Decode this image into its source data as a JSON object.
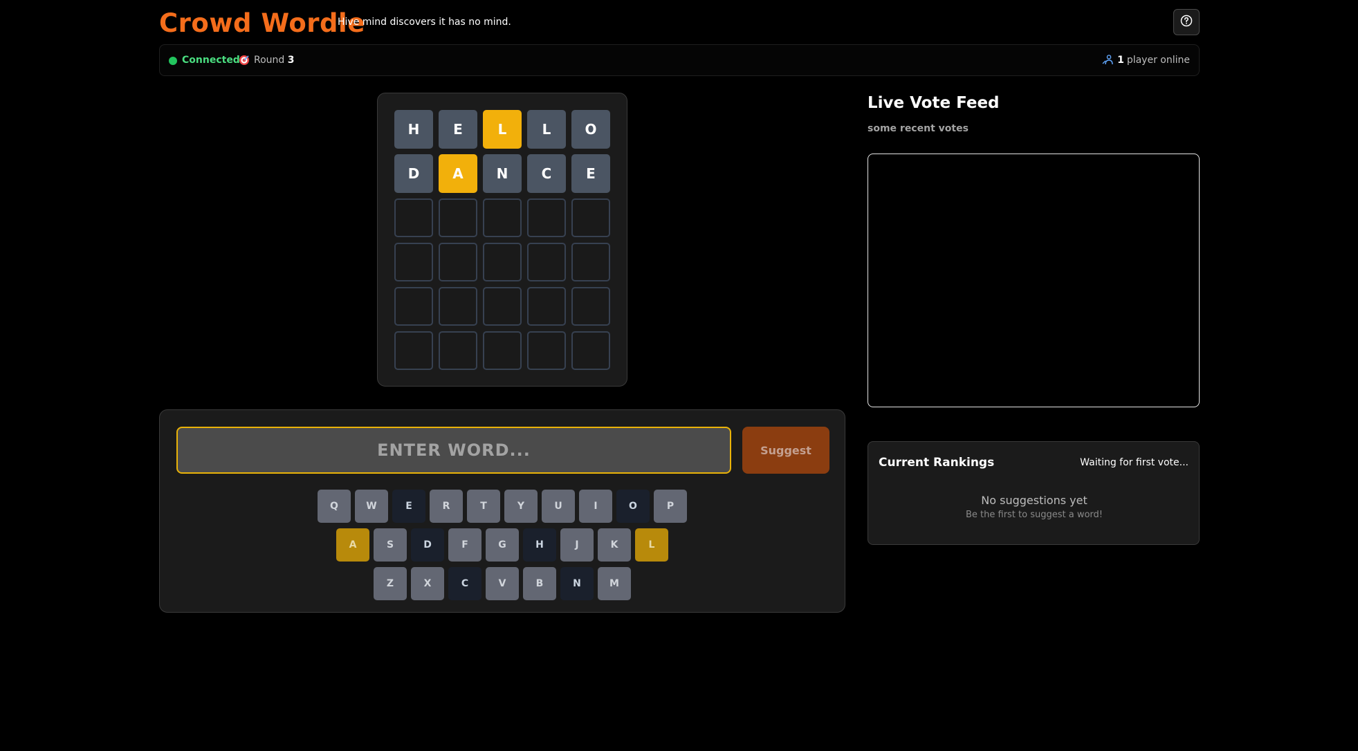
{
  "header": {
    "title": "Crowd Wordle",
    "tagline": "Hive mind discovers it has no mind.",
    "help_icon": "question-circle-icon"
  },
  "status": {
    "connection": "Connected",
    "round_label": "Round",
    "round_number": "3",
    "players_count": "1",
    "players_label": "player online",
    "colors": {
      "connected": "#22c55e"
    }
  },
  "board": {
    "rows": [
      [
        {
          "l": "H",
          "s": "absent"
        },
        {
          "l": "E",
          "s": "absent"
        },
        {
          "l": "L",
          "s": "present"
        },
        {
          "l": "L",
          "s": "absent"
        },
        {
          "l": "O",
          "s": "absent"
        }
      ],
      [
        {
          "l": "D",
          "s": "absent"
        },
        {
          "l": "A",
          "s": "present"
        },
        {
          "l": "N",
          "s": "absent"
        },
        {
          "l": "C",
          "s": "absent"
        },
        {
          "l": "E",
          "s": "absent"
        }
      ],
      [
        {
          "l": "",
          "s": "empty"
        },
        {
          "l": "",
          "s": "empty"
        },
        {
          "l": "",
          "s": "empty"
        },
        {
          "l": "",
          "s": "empty"
        },
        {
          "l": "",
          "s": "empty"
        }
      ],
      [
        {
          "l": "",
          "s": "empty"
        },
        {
          "l": "",
          "s": "empty"
        },
        {
          "l": "",
          "s": "empty"
        },
        {
          "l": "",
          "s": "empty"
        },
        {
          "l": "",
          "s": "empty"
        }
      ],
      [
        {
          "l": "",
          "s": "empty"
        },
        {
          "l": "",
          "s": "empty"
        },
        {
          "l": "",
          "s": "empty"
        },
        {
          "l": "",
          "s": "empty"
        },
        {
          "l": "",
          "s": "empty"
        }
      ],
      [
        {
          "l": "",
          "s": "empty"
        },
        {
          "l": "",
          "s": "empty"
        },
        {
          "l": "",
          "s": "empty"
        },
        {
          "l": "",
          "s": "empty"
        },
        {
          "l": "",
          "s": "empty"
        }
      ]
    ],
    "colors": {
      "absent": "#4b5563",
      "present": "#f2b00b"
    }
  },
  "input": {
    "value": "",
    "placeholder": "ENTER WORD...",
    "suggest_label": "Suggest"
  },
  "keyboard": {
    "rows": [
      [
        {
          "k": "Q",
          "s": "unused"
        },
        {
          "k": "W",
          "s": "unused"
        },
        {
          "k": "E",
          "s": "absent"
        },
        {
          "k": "R",
          "s": "unused"
        },
        {
          "k": "T",
          "s": "unused"
        },
        {
          "k": "Y",
          "s": "unused"
        },
        {
          "k": "U",
          "s": "unused"
        },
        {
          "k": "I",
          "s": "unused"
        },
        {
          "k": "O",
          "s": "absent"
        },
        {
          "k": "P",
          "s": "unused"
        }
      ],
      [
        {
          "k": "A",
          "s": "present"
        },
        {
          "k": "S",
          "s": "unused"
        },
        {
          "k": "D",
          "s": "absent"
        },
        {
          "k": "F",
          "s": "unused"
        },
        {
          "k": "G",
          "s": "unused"
        },
        {
          "k": "H",
          "s": "absent"
        },
        {
          "k": "J",
          "s": "unused"
        },
        {
          "k": "K",
          "s": "unused"
        },
        {
          "k": "L",
          "s": "present"
        }
      ],
      [
        {
          "k": "Z",
          "s": "unused"
        },
        {
          "k": "X",
          "s": "unused"
        },
        {
          "k": "C",
          "s": "absent"
        },
        {
          "k": "V",
          "s": "unused"
        },
        {
          "k": "B",
          "s": "unused"
        },
        {
          "k": "N",
          "s": "absent"
        },
        {
          "k": "M",
          "s": "unused"
        }
      ]
    ]
  },
  "feed": {
    "title": "Live Vote Feed",
    "subtitle": "some recent votes"
  },
  "rankings": {
    "title": "Current Rankings",
    "status": "Waiting for first vote...",
    "empty_text": "No suggestions yet",
    "empty_hint": "Be the first to suggest a word!"
  }
}
